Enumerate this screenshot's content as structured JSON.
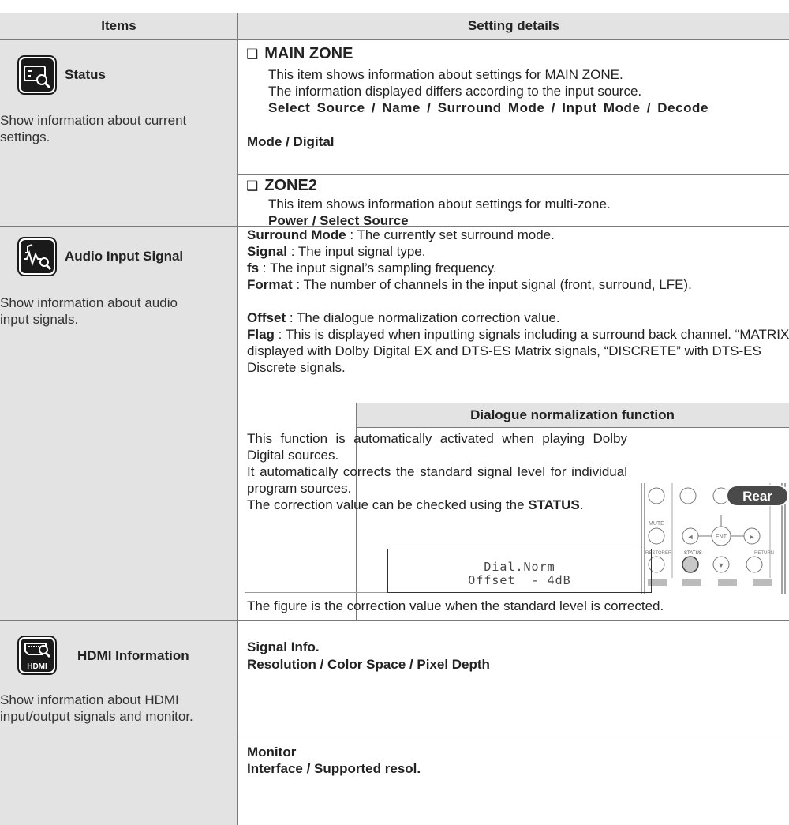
{
  "table": {
    "col1_header": "Items",
    "col2_header": "Setting details"
  },
  "status": {
    "title": "Status",
    "desc": "Show information about current settings.",
    "main_zone": {
      "heading": "MAIN ZONE",
      "line1": "This item shows information about settings for MAIN ZONE.",
      "line2": "The information displayed differs according to the input source.",
      "fields_line1": "Select Source / Name / Surround Mode / Input Mode / Decode",
      "fields_line2": "Mode / Digital"
    },
    "zone2": {
      "heading": "ZONE2",
      "line1": "This item shows information about settings for multi-zone.",
      "fields": "Power / Select Source"
    }
  },
  "audio": {
    "title": "Audio Input Signal",
    "desc": "Show information about audio input signals.",
    "rows": [
      {
        "term": "Surround Mode",
        "def": " : The currently set surround mode."
      },
      {
        "term": "Signal",
        "def": " : The input signal type."
      },
      {
        "term": "fs",
        "def": " : The input signal’s sampling frequency."
      },
      {
        "term": "Format",
        "def": " : The number of channels in the input signal (front, surround, LFE)."
      },
      {
        "term": "Offset",
        "def": " : The dialogue normalization correction value."
      },
      {
        "term": "Flag",
        "def": " : This is displayed when inputting signals including a surround back channel. “MATRIX” is displayed with Dolby Digital EX and DTS-ES Matrix signals, “DISCRETE” with DTS-ES Discrete signals."
      }
    ],
    "dialnorm": {
      "heading": "Dialogue normalization function",
      "para1": "This function is automatically activated when playing Dolby Digital sources.",
      "para2": "It automatically corrects the standard signal level for individual program sources.",
      "para3_prefix": "The correction value can be checked using the",
      "para3_bold": "STATUS",
      "para3_suffix": ".",
      "remote": {
        "badge": "Rear",
        "labels": [
          "MUTE",
          "ENT",
          "RESTORER",
          "STATUS",
          "RETURN"
        ]
      },
      "display_line1": "Dial.Norm",
      "display_line2": "Offset  - 4dB",
      "caption": "The figure is the correction value when the standard level is corrected."
    }
  },
  "hdmi": {
    "title": "HDMI Information",
    "icon_label": "HDMI",
    "desc": "Show information about HDMI input/output signals and monitor.",
    "signal_info_title": "Signal Info.",
    "signal_info_fields": "Resolution / Color Space / Pixel Depth",
    "monitor_title": "Monitor",
    "monitor_fields": "Interface / Supported resol."
  },
  "colors": {
    "left_panel": "#e3e3e3",
    "rule": "#7a7a7a",
    "icon_bg": "#1a1a1a"
  }
}
